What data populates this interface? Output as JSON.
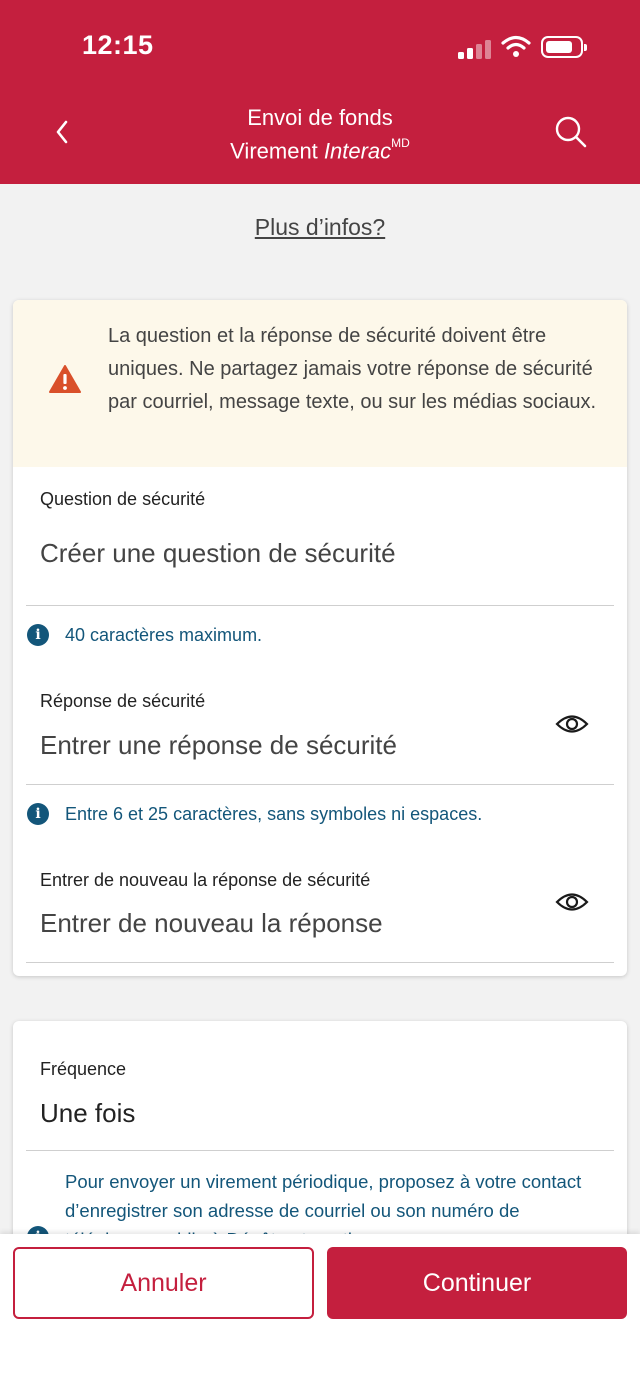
{
  "status_bar": {
    "time": "12:15"
  },
  "header": {
    "title_line1": "Envoi de fonds",
    "title_line2_prefix": "Virement ",
    "title_line2_brand": "Interac",
    "title_line2_mark": "MD"
  },
  "more_info_link": "Plus d’infos?",
  "warning_text": "La question et la réponse de sécurité doivent être uniques. Ne partagez jamais votre réponse de sécurité par courriel, message texte, ou sur les médias sociaux.",
  "security_question": {
    "label": "Question de sécurité",
    "placeholder": "Créer une question de sécurité",
    "hint": "40 caractères maximum."
  },
  "security_answer": {
    "label": "Réponse de sécurité",
    "placeholder": "Entrer une réponse de sécurité",
    "hint": "Entre 6 et 25 caractères, sans symboles ni espaces."
  },
  "confirm_answer": {
    "label": "Entrer de nouveau la réponse de sécurité",
    "placeholder": "Entrer de nouveau la réponse"
  },
  "frequency": {
    "label": "Fréquence",
    "value": "Une fois",
    "hint": "Pour envoyer un virement périodique, proposez à votre contact d’enregistrer son adresse de courriel ou son numéro de téléphone mobile à Dépôt automatique."
  },
  "actions": {
    "cancel": "Annuler",
    "continue": "Continuer"
  },
  "colors": {
    "brand": "#c41f3e",
    "info": "#13567a",
    "warning_bg": "#fdf8ea",
    "warning_icon": "#d9502a"
  }
}
